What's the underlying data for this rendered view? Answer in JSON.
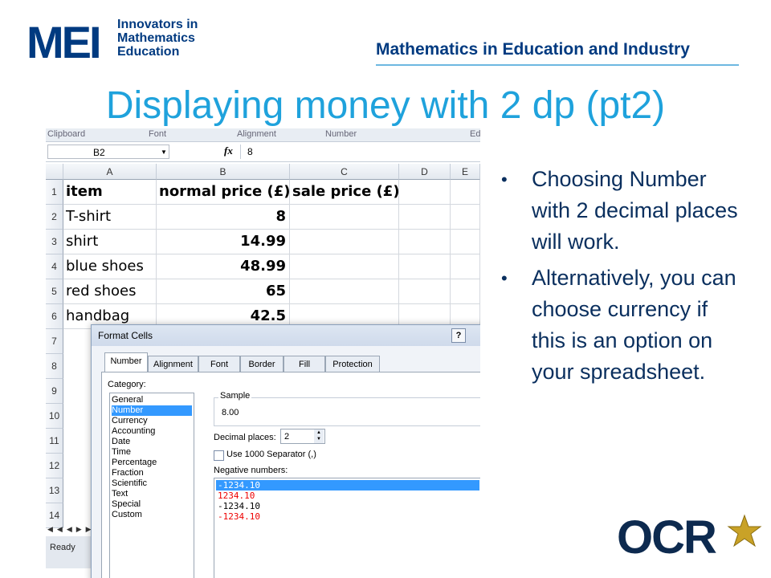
{
  "header": {
    "logo_text": "MEI",
    "logo_tagline": [
      "Innovators in",
      "Mathematics",
      "Education"
    ],
    "subtitle": "Mathematics in Education and Industry"
  },
  "title": "Displaying money with 2 dp (pt2)",
  "excel": {
    "ribbon_groups": [
      "Clipboard",
      "Font",
      "Alignment",
      "Number",
      "Ed"
    ],
    "name_box": "B2",
    "formula_value": "8",
    "columns": [
      "A",
      "B",
      "C",
      "D",
      "E"
    ],
    "row_numbers": [
      "1",
      "2",
      "3",
      "4",
      "5",
      "6",
      "7",
      "8",
      "9",
      "10",
      "11",
      "12",
      "13",
      "14"
    ],
    "rows": [
      [
        "item",
        "normal price (£)",
        "sale price (£)"
      ],
      [
        "T-shirt",
        "8",
        ""
      ],
      [
        "shirt",
        "14.99",
        ""
      ],
      [
        "blue shoes",
        "48.99",
        ""
      ],
      [
        "red shoes",
        "65",
        ""
      ],
      [
        "handbag",
        "42.5",
        ""
      ]
    ],
    "status": "Ready",
    "sheet_nav": "◀◀◀▶▶▶"
  },
  "dialog": {
    "title": "Format Cells",
    "help": "?",
    "tabs": [
      "Number",
      "Alignment",
      "Font",
      "Border",
      "Fill",
      "Protection"
    ],
    "category_label": "Category:",
    "categories": [
      "General",
      "Number",
      "Currency",
      "Accounting",
      "Date",
      "Time",
      "Percentage",
      "Fraction",
      "Scientific",
      "Text",
      "Special",
      "Custom"
    ],
    "selected_category": "Number",
    "sample_label": "Sample",
    "sample_value": "8.00",
    "decimal_label": "Decimal places:",
    "decimal_value": "2",
    "separator_label": "Use 1000 Separator (,)",
    "negative_label": "Negative numbers:",
    "negative_options": [
      "-1234.10",
      "1234.10",
      "-1234.10",
      "-1234.10"
    ]
  },
  "bullets": [
    "Choosing Number with 2 decimal places will work.",
    "Alternatively, you can choose currency if this is an option on your spreadsheet."
  ],
  "ocr_logo": "OCR"
}
